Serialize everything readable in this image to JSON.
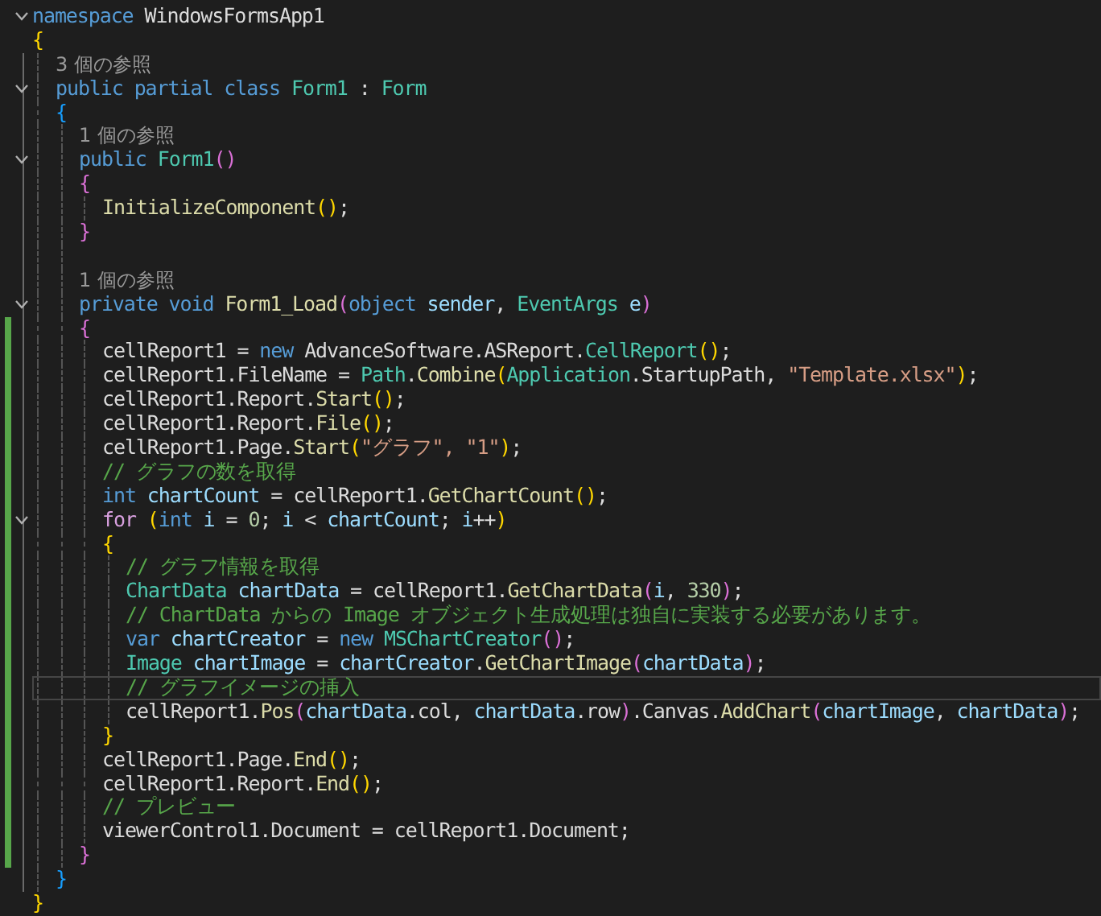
{
  "editor": {
    "lines": [
      {
        "kind": "header",
        "expanded": true,
        "changed": false,
        "current": false,
        "tokens": [
          {
            "kind": "keyword",
            "text": "namespace "
          },
          {
            "kind": "plain",
            "text": "WindowsFormsApp1"
          }
        ]
      },
      {
        "kind": "code",
        "changed": false,
        "current": false,
        "tokens": [
          {
            "kind": "paren1",
            "text": "{"
          }
        ],
        "children": [
          {
            "kind": "codelens",
            "changed": false,
            "current": false,
            "tokens": [
              {
                "kind": "lens",
                "text": "3 個の参照"
              }
            ]
          },
          {
            "kind": "header",
            "expanded": true,
            "changed": false,
            "current": false,
            "tokens": [
              {
                "kind": "keyword",
                "text": "public partial class "
              },
              {
                "kind": "type",
                "text": "Form1"
              },
              {
                "kind": "plain",
                "text": " : "
              },
              {
                "kind": "type",
                "text": "Form"
              }
            ]
          },
          {
            "kind": "code",
            "changed": false,
            "current": false,
            "tokens": [
              {
                "kind": "paren3",
                "text": "{"
              }
            ],
            "children": [
              {
                "kind": "codelens",
                "changed": false,
                "current": false,
                "tokens": [
                  {
                    "kind": "lens",
                    "text": "1 個の参照"
                  }
                ]
              },
              {
                "kind": "header",
                "expanded": true,
                "changed": false,
                "current": false,
                "tokens": [
                  {
                    "kind": "keyword",
                    "text": "public "
                  },
                  {
                    "kind": "type",
                    "text": "Form1"
                  },
                  {
                    "kind": "paren2",
                    "text": "()"
                  }
                ]
              },
              {
                "kind": "code",
                "changed": false,
                "current": false,
                "tokens": [
                  {
                    "kind": "paren2",
                    "text": "{"
                  }
                ],
                "children": [
                  {
                    "kind": "code",
                    "changed": false,
                    "current": false,
                    "tokens": [
                      {
                        "kind": "method",
                        "text": "InitializeComponent"
                      },
                      {
                        "kind": "paren1",
                        "text": "()"
                      },
                      {
                        "kind": "plain",
                        "text": ";"
                      }
                    ]
                  }
                ]
              },
              {
                "kind": "code",
                "changed": false,
                "current": false,
                "tokens": [
                  {
                    "kind": "paren2",
                    "text": "}"
                  }
                ]
              },
              {
                "kind": "blank",
                "changed": false,
                "current": false
              },
              {
                "kind": "codelens",
                "changed": false,
                "current": false,
                "tokens": [
                  {
                    "kind": "lens",
                    "text": "1 個の参照"
                  }
                ]
              },
              {
                "kind": "header",
                "expanded": true,
                "changed": false,
                "current": false,
                "tokens": [
                  {
                    "kind": "keyword",
                    "text": "private void "
                  },
                  {
                    "kind": "method",
                    "text": "Form1_Load"
                  },
                  {
                    "kind": "paren2",
                    "text": "("
                  },
                  {
                    "kind": "keyword",
                    "text": "object "
                  },
                  {
                    "kind": "local",
                    "text": "sender"
                  },
                  {
                    "kind": "plain",
                    "text": ", "
                  },
                  {
                    "kind": "type",
                    "text": "EventArgs "
                  },
                  {
                    "kind": "local",
                    "text": "e"
                  },
                  {
                    "kind": "paren2",
                    "text": ")"
                  }
                ]
              },
              {
                "kind": "code",
                "changed": true,
                "current": false,
                "tokens": [
                  {
                    "kind": "paren2",
                    "text": "{"
                  }
                ],
                "children": [
                  {
                    "kind": "code",
                    "changed": true,
                    "current": false,
                    "tokens": [
                      {
                        "kind": "plain",
                        "text": "cellReport1 = "
                      },
                      {
                        "kind": "keyword",
                        "text": "new "
                      },
                      {
                        "kind": "plain",
                        "text": "AdvanceSoftware.ASReport."
                      },
                      {
                        "kind": "type",
                        "text": "CellReport"
                      },
                      {
                        "kind": "paren1",
                        "text": "()"
                      },
                      {
                        "kind": "plain",
                        "text": ";"
                      }
                    ]
                  },
                  {
                    "kind": "code",
                    "changed": true,
                    "current": false,
                    "tokens": [
                      {
                        "kind": "plain",
                        "text": "cellReport1."
                      },
                      {
                        "kind": "member",
                        "text": "FileName"
                      },
                      {
                        "kind": "plain",
                        "text": " = "
                      },
                      {
                        "kind": "type",
                        "text": "Path"
                      },
                      {
                        "kind": "plain",
                        "text": "."
                      },
                      {
                        "kind": "method",
                        "text": "Combine"
                      },
                      {
                        "kind": "paren1",
                        "text": "("
                      },
                      {
                        "kind": "type",
                        "text": "Application"
                      },
                      {
                        "kind": "plain",
                        "text": ".StartupPath, "
                      },
                      {
                        "kind": "string",
                        "text": "\"Template.xlsx\""
                      },
                      {
                        "kind": "paren1",
                        "text": ")"
                      },
                      {
                        "kind": "plain",
                        "text": ";"
                      }
                    ]
                  },
                  {
                    "kind": "code",
                    "changed": true,
                    "current": false,
                    "tokens": [
                      {
                        "kind": "plain",
                        "text": "cellReport1."
                      },
                      {
                        "kind": "member",
                        "text": "Report"
                      },
                      {
                        "kind": "plain",
                        "text": "."
                      },
                      {
                        "kind": "method",
                        "text": "Start"
                      },
                      {
                        "kind": "paren1",
                        "text": "()"
                      },
                      {
                        "kind": "plain",
                        "text": ";"
                      }
                    ]
                  },
                  {
                    "kind": "code",
                    "changed": true,
                    "current": false,
                    "tokens": [
                      {
                        "kind": "plain",
                        "text": "cellReport1."
                      },
                      {
                        "kind": "member",
                        "text": "Report"
                      },
                      {
                        "kind": "plain",
                        "text": "."
                      },
                      {
                        "kind": "method",
                        "text": "File"
                      },
                      {
                        "kind": "paren1",
                        "text": "()"
                      },
                      {
                        "kind": "plain",
                        "text": ";"
                      }
                    ]
                  },
                  {
                    "kind": "code",
                    "changed": true,
                    "current": false,
                    "tokens": [
                      {
                        "kind": "plain",
                        "text": "cellReport1."
                      },
                      {
                        "kind": "member",
                        "text": "Page"
                      },
                      {
                        "kind": "plain",
                        "text": "."
                      },
                      {
                        "kind": "method",
                        "text": "Start"
                      },
                      {
                        "kind": "paren1",
                        "text": "("
                      },
                      {
                        "kind": "string",
                        "text": "\"グラフ\", \"1\""
                      },
                      {
                        "kind": "paren1",
                        "text": ")"
                      },
                      {
                        "kind": "plain",
                        "text": ";"
                      }
                    ]
                  },
                  {
                    "kind": "code",
                    "changed": true,
                    "current": false,
                    "tokens": [
                      {
                        "kind": "comment",
                        "text": "// グラフの数を取得"
                      }
                    ]
                  },
                  {
                    "kind": "code",
                    "changed": true,
                    "current": false,
                    "tokens": [
                      {
                        "kind": "keyword",
                        "text": "int "
                      },
                      {
                        "kind": "local",
                        "text": "chartCount"
                      },
                      {
                        "kind": "plain",
                        "text": " = cellReport1."
                      },
                      {
                        "kind": "method",
                        "text": "GetChartCount"
                      },
                      {
                        "kind": "paren1",
                        "text": "()"
                      },
                      {
                        "kind": "plain",
                        "text": ";"
                      }
                    ]
                  },
                  {
                    "kind": "header",
                    "expanded": true,
                    "changed": true,
                    "current": false,
                    "tokens": [
                      {
                        "kind": "control",
                        "text": "for "
                      },
                      {
                        "kind": "paren1",
                        "text": "("
                      },
                      {
                        "kind": "keyword",
                        "text": "int "
                      },
                      {
                        "kind": "local",
                        "text": "i"
                      },
                      {
                        "kind": "plain",
                        "text": " = "
                      },
                      {
                        "kind": "number",
                        "text": "0"
                      },
                      {
                        "kind": "plain",
                        "text": "; "
                      },
                      {
                        "kind": "local",
                        "text": "i"
                      },
                      {
                        "kind": "plain",
                        "text": " < "
                      },
                      {
                        "kind": "local",
                        "text": "chartCount"
                      },
                      {
                        "kind": "plain",
                        "text": "; "
                      },
                      {
                        "kind": "local",
                        "text": "i"
                      },
                      {
                        "kind": "plain",
                        "text": "++"
                      },
                      {
                        "kind": "paren1",
                        "text": ")"
                      }
                    ]
                  },
                  {
                    "kind": "code",
                    "changed": true,
                    "current": false,
                    "tokens": [
                      {
                        "kind": "paren1",
                        "text": "{"
                      }
                    ],
                    "children": [
                      {
                        "kind": "code",
                        "changed": true,
                        "current": false,
                        "tokens": [
                          {
                            "kind": "comment",
                            "text": "// グラフ情報を取得"
                          }
                        ]
                      },
                      {
                        "kind": "code",
                        "changed": true,
                        "current": false,
                        "tokens": [
                          {
                            "kind": "type",
                            "text": "ChartData "
                          },
                          {
                            "kind": "local",
                            "text": "chartData"
                          },
                          {
                            "kind": "plain",
                            "text": " = cellReport1."
                          },
                          {
                            "kind": "method",
                            "text": "GetChartData"
                          },
                          {
                            "kind": "paren2",
                            "text": "("
                          },
                          {
                            "kind": "local",
                            "text": "i"
                          },
                          {
                            "kind": "plain",
                            "text": ", "
                          },
                          {
                            "kind": "number",
                            "text": "330"
                          },
                          {
                            "kind": "paren2",
                            "text": ")"
                          },
                          {
                            "kind": "plain",
                            "text": ";"
                          }
                        ]
                      },
                      {
                        "kind": "code",
                        "changed": true,
                        "current": false,
                        "tokens": [
                          {
                            "kind": "comment",
                            "text": "// ChartData からの Image オブジェクト生成処理は独自に実装する必要があります。"
                          }
                        ]
                      },
                      {
                        "kind": "code",
                        "changed": true,
                        "current": false,
                        "tokens": [
                          {
                            "kind": "keyword",
                            "text": "var "
                          },
                          {
                            "kind": "local",
                            "text": "chartCreator"
                          },
                          {
                            "kind": "plain",
                            "text": " = "
                          },
                          {
                            "kind": "keyword",
                            "text": "new "
                          },
                          {
                            "kind": "type",
                            "text": "MSChartCreator"
                          },
                          {
                            "kind": "paren2",
                            "text": "()"
                          },
                          {
                            "kind": "plain",
                            "text": ";"
                          }
                        ]
                      },
                      {
                        "kind": "code",
                        "changed": true,
                        "current": false,
                        "tokens": [
                          {
                            "kind": "type",
                            "text": "Image "
                          },
                          {
                            "kind": "local",
                            "text": "chartImage"
                          },
                          {
                            "kind": "plain",
                            "text": " = "
                          },
                          {
                            "kind": "local",
                            "text": "chartCreator"
                          },
                          {
                            "kind": "plain",
                            "text": "."
                          },
                          {
                            "kind": "method",
                            "text": "GetChartImage"
                          },
                          {
                            "kind": "paren2",
                            "text": "("
                          },
                          {
                            "kind": "local",
                            "text": "chartData"
                          },
                          {
                            "kind": "paren2",
                            "text": ")"
                          },
                          {
                            "kind": "plain",
                            "text": ";"
                          }
                        ]
                      },
                      {
                        "kind": "code",
                        "changed": true,
                        "current": true,
                        "tokens": [
                          {
                            "kind": "comment",
                            "text": "// グラフイメージの挿入"
                          }
                        ]
                      },
                      {
                        "kind": "code",
                        "changed": true,
                        "current": false,
                        "tokens": [
                          {
                            "kind": "plain",
                            "text": "cellReport1."
                          },
                          {
                            "kind": "method",
                            "text": "Pos"
                          },
                          {
                            "kind": "paren2",
                            "text": "("
                          },
                          {
                            "kind": "local",
                            "text": "chartData"
                          },
                          {
                            "kind": "plain",
                            "text": ".col, "
                          },
                          {
                            "kind": "local",
                            "text": "chartData"
                          },
                          {
                            "kind": "plain",
                            "text": ".row"
                          },
                          {
                            "kind": "paren2",
                            "text": ")"
                          },
                          {
                            "kind": "plain",
                            "text": ".Canvas."
                          },
                          {
                            "kind": "method",
                            "text": "AddChart"
                          },
                          {
                            "kind": "paren2",
                            "text": "("
                          },
                          {
                            "kind": "local",
                            "text": "chartImage"
                          },
                          {
                            "kind": "plain",
                            "text": ", "
                          },
                          {
                            "kind": "local",
                            "text": "chartData"
                          },
                          {
                            "kind": "paren2",
                            "text": ")"
                          },
                          {
                            "kind": "plain",
                            "text": ";"
                          }
                        ]
                      }
                    ]
                  },
                  {
                    "kind": "code",
                    "changed": true,
                    "current": false,
                    "tokens": [
                      {
                        "kind": "paren1",
                        "text": "}"
                      }
                    ]
                  },
                  {
                    "kind": "code",
                    "changed": true,
                    "current": false,
                    "tokens": [
                      {
                        "kind": "plain",
                        "text": "cellReport1."
                      },
                      {
                        "kind": "member",
                        "text": "Page"
                      },
                      {
                        "kind": "plain",
                        "text": "."
                      },
                      {
                        "kind": "method",
                        "text": "End"
                      },
                      {
                        "kind": "paren1",
                        "text": "()"
                      },
                      {
                        "kind": "plain",
                        "text": ";"
                      }
                    ]
                  },
                  {
                    "kind": "code",
                    "changed": true,
                    "current": false,
                    "tokens": [
                      {
                        "kind": "plain",
                        "text": "cellReport1."
                      },
                      {
                        "kind": "member",
                        "text": "Report"
                      },
                      {
                        "kind": "plain",
                        "text": "."
                      },
                      {
                        "kind": "method",
                        "text": "End"
                      },
                      {
                        "kind": "paren1",
                        "text": "()"
                      },
                      {
                        "kind": "plain",
                        "text": ";"
                      }
                    ]
                  },
                  {
                    "kind": "code",
                    "changed": true,
                    "current": false,
                    "tokens": [
                      {
                        "kind": "comment",
                        "text": "// プレビュー"
                      }
                    ]
                  },
                  {
                    "kind": "code",
                    "changed": true,
                    "current": false,
                    "tokens": [
                      {
                        "kind": "plain",
                        "text": "viewerControl1."
                      },
                      {
                        "kind": "member",
                        "text": "Document"
                      },
                      {
                        "kind": "plain",
                        "text": " = cellReport1."
                      },
                      {
                        "kind": "member",
                        "text": "Document"
                      },
                      {
                        "kind": "plain",
                        "text": ";"
                      }
                    ]
                  }
                ]
              },
              {
                "kind": "code",
                "changed": true,
                "current": false,
                "tokens": [
                  {
                    "kind": "paren2",
                    "text": "}"
                  }
                ]
              }
            ]
          },
          {
            "kind": "code",
            "changed": false,
            "current": false,
            "tokens": [
              {
                "kind": "paren3",
                "text": "}"
              }
            ]
          }
        ]
      },
      {
        "kind": "code",
        "changed": false,
        "current": false,
        "tokens": [
          {
            "kind": "paren1",
            "text": "}"
          }
        ]
      }
    ]
  }
}
